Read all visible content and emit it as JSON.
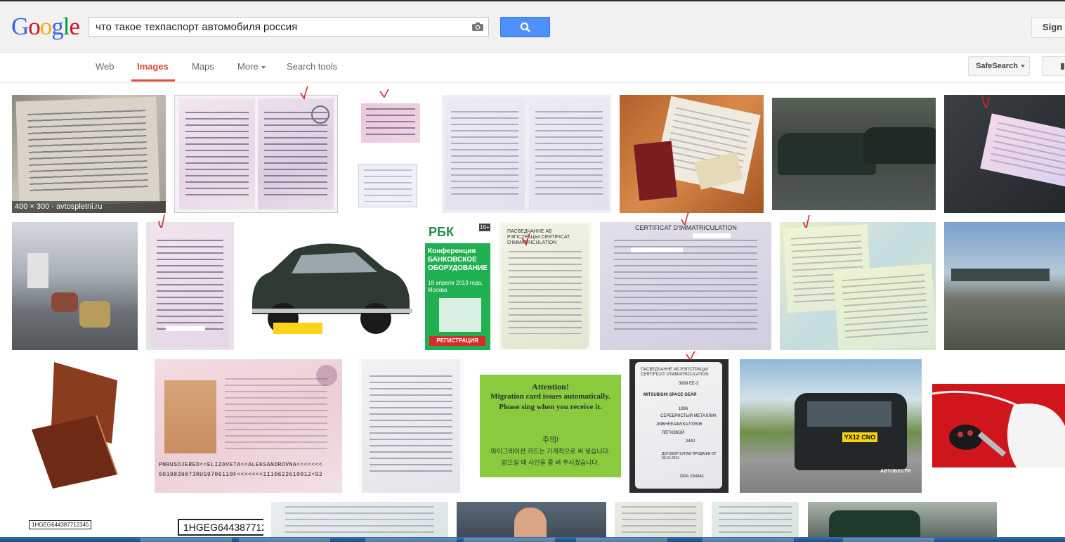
{
  "logo": {
    "text": "Google"
  },
  "search": {
    "query": "что такое техпаспорт автомобиля россия",
    "button_icon": "magnifier-icon",
    "camera_icon": "camera-icon"
  },
  "header": {
    "signin_label": "Sign i"
  },
  "nav": {
    "web": "Web",
    "images": "Images",
    "maps": "Maps",
    "more": "More",
    "search_tools": "Search tools",
    "safesearch": "SafeSearch"
  },
  "results": {
    "first_info": "400 × 300 - avtospletni.ru",
    "rbk": {
      "brand": "РБК",
      "age": "16+",
      "title": "Конференция БАНКОВСКОЕ ОБОРУДОВАНИЕ",
      "date": "18 апреля 2013 года, Москва",
      "cta": "РЕГИСТРАЦИЯ"
    },
    "doc_header": "ПАСВЕДЧАННЕ АБ РЭГІСТРАЦЫІ CERTIFICAT D'IMMATRICULATION",
    "cert_header": "CERTIFICAT D'IMMATRICULATION",
    "migration": {
      "line1": "Attention!",
      "line2": "Migration card issues automatically.",
      "line3": "Please sing when you receive it.",
      "line4": "주의!",
      "line5": "마이그레이션 카드는 기계적으로 써 넣습니다.",
      "line6": "받으실 때 사인을 좀 써 주시겠습니다."
    },
    "mrz1": "PNRUSOJERED<<ELIZAVETA<<ALEKSANDROVNA<<<<<<<",
    "mrz2": "6019839073RUS9706110F<<<<<<<1110622610012<92",
    "plate": "YX12 CNO",
    "watermark": "АВТОВЕСТИ",
    "vin": "1HGEG644387712345",
    "mitsubishi": {
      "model": "MITSUBISHI SPACE GEAR",
      "reg": "3999 EE-3",
      "color": "СЕРЕБРИСТЫЙ МЕТАЛЛИК",
      "vin": "JMBHEEA4WSA700506",
      "kind": "ЛЕГКОВОЙ",
      "year": "1996",
      "mass": "2440",
      "basis": "ДОГОВОР КУПЛИ-ПРОДАЖИ ОТ 03.01.2011",
      "serial": "ОАА 154341"
    }
  },
  "colors": {
    "accent": "#dd4b39",
    "search_blue": "#4d90fe",
    "tick_red": "#d8232a"
  }
}
